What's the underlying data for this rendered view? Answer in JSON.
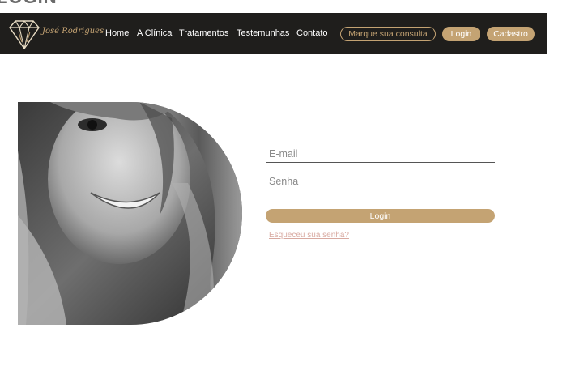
{
  "page": {
    "title": "LOGIN"
  },
  "colors": {
    "accent": "#c4a373",
    "navbar_bg": "#1f1e1c",
    "link_pink": "#d8a9a0"
  },
  "navbar": {
    "logo": {
      "icon": "diamond-tooth-icon",
      "text": "José Rodrigues"
    },
    "links": [
      {
        "label": "Home"
      },
      {
        "label": "A Clínica"
      },
      {
        "label": "Tratamentos"
      },
      {
        "label": "Testemunhas"
      },
      {
        "label": "Contato"
      }
    ],
    "cta_label": "Marque sua consulta",
    "login_label": "Login",
    "signup_label": "Cadastro"
  },
  "hero_image": {
    "icon": "smiling-woman-photo"
  },
  "form": {
    "email": {
      "placeholder": "E-mail",
      "value": ""
    },
    "password": {
      "placeholder": "Senha",
      "value": ""
    },
    "submit_label": "Login",
    "forgot_label": "Esqueceu sua senha?"
  }
}
